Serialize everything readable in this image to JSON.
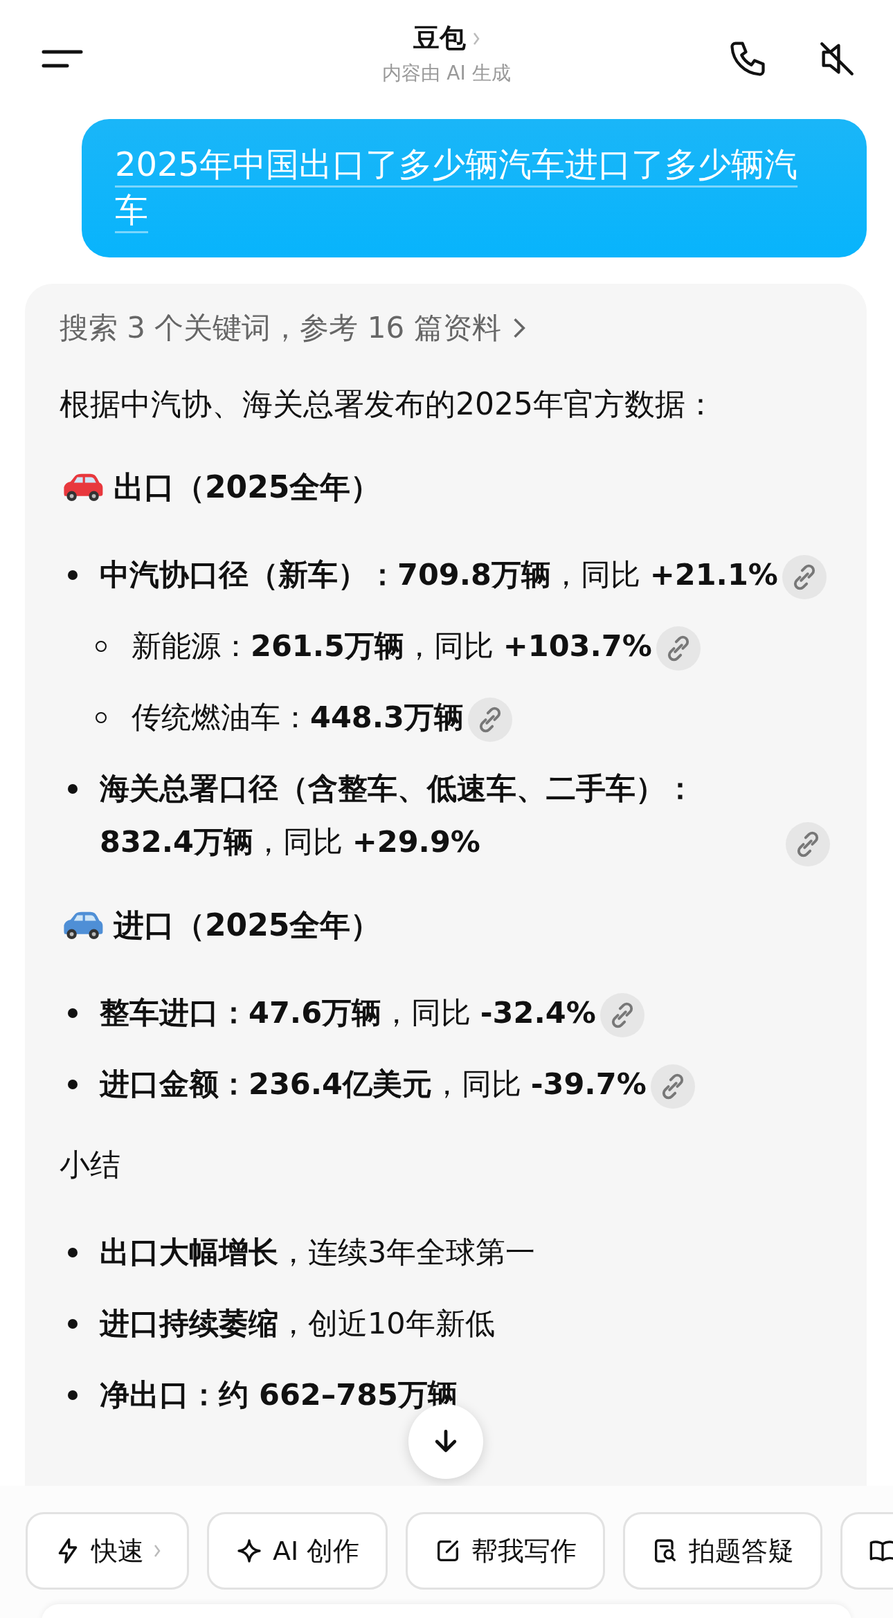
{
  "header": {
    "title": "豆包",
    "subtitle": "内容由 AI 生成"
  },
  "user_message": {
    "text": "2025年中国出口了多少辆汽车进口了多少辆汽车"
  },
  "answer": {
    "search_summary": "搜索 3 个关键词，参考 16 篇资料",
    "intro": "根据中汽协、海关总署发布的2025年官方数据：",
    "sections": [
      {
        "heading": "出口（2025全年）",
        "color": "#e8383d",
        "items": [
          {
            "text": "**中汽协口径（新车）：709.8万辆**，同比 **+21.1%**",
            "cited": true,
            "children": [
              {
                "text": "新能源：**261.5万辆**，同比 **+103.7%**",
                "cited": true
              },
              {
                "text": "传统燃油车：**448.3万辆**",
                "cited": true
              }
            ]
          },
          {
            "text": "**海关总署口径（含整车、低速车、二手车）：832.4万辆**，同比 **+29.9%**",
            "cited": true
          }
        ]
      },
      {
        "heading": "进口（2025全年）",
        "color": "#4f8fd6",
        "items": [
          {
            "text": "**整车进口：47.6万辆**，同比 **-32.4%**",
            "cited": true
          },
          {
            "text": "**进口金额：236.4亿美元**，同比 **-39.7%**",
            "cited": true
          }
        ]
      }
    ],
    "summary_heading": "小结",
    "summary_items": [
      {
        "text": "**出口大幅增长**，连续3年全球第一"
      },
      {
        "text": "**进口持续萎缩**，创近10年新低"
      },
      {
        "text": "**净出口：约 662–785万辆**"
      }
    ]
  },
  "toolbar": [
    {
      "kind": "bolt",
      "label": "快速",
      "chevron": true
    },
    {
      "kind": "sparkle",
      "label": "AI 创作"
    },
    {
      "kind": "edit",
      "label": "帮我写作"
    },
    {
      "kind": "doc-search",
      "label": "拍题答疑"
    },
    {
      "kind": "book"
    }
  ]
}
